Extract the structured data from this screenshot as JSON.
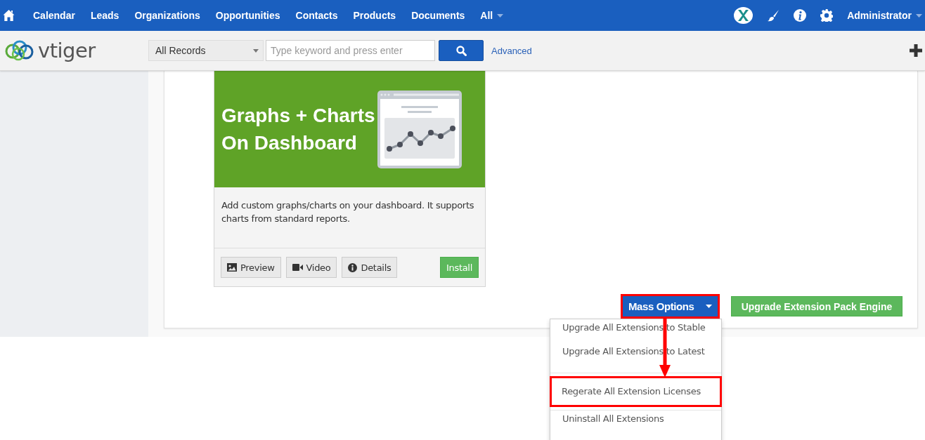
{
  "top_nav": {
    "items": [
      "Calendar",
      "Leads",
      "Organizations",
      "Opportunities",
      "Contacts",
      "Products",
      "Documents"
    ],
    "all_menu": "All",
    "user": "Administrator"
  },
  "search_bar": {
    "logo_text": "vtiger",
    "filter": "All Records",
    "placeholder": "Type keyword and press enter",
    "advanced_link": "Advanced"
  },
  "extension_card": {
    "banner_title": "Graphs + Charts On Dashboard",
    "description": "Add custom graphs/charts on your dashboard. It supports charts from standard reports.",
    "buttons": [
      {
        "label": "Preview",
        "kind": "preview"
      },
      {
        "label": "Video",
        "kind": "video"
      },
      {
        "label": "Details",
        "kind": "details"
      }
    ],
    "install_button": "Install"
  },
  "actions": {
    "mass_options": {
      "label": "Mass Options",
      "highlighted": true,
      "expanded": true
    },
    "upgrade_engine_button": "Upgrade Extension Pack Engine"
  },
  "mass_options_menu": [
    {
      "label": "Upgrade All Extensions to Stable",
      "divider_before": false,
      "highlighted": false
    },
    {
      "label": "Upgrade All Extensions to Latest",
      "divider_before": false,
      "highlighted": false
    },
    {
      "label": "Regerate All Extension Licenses",
      "divider_before": true,
      "highlighted": true
    },
    {
      "label": "Uninstall All Extensions",
      "divider_before": true,
      "highlighted": false
    }
  ]
}
